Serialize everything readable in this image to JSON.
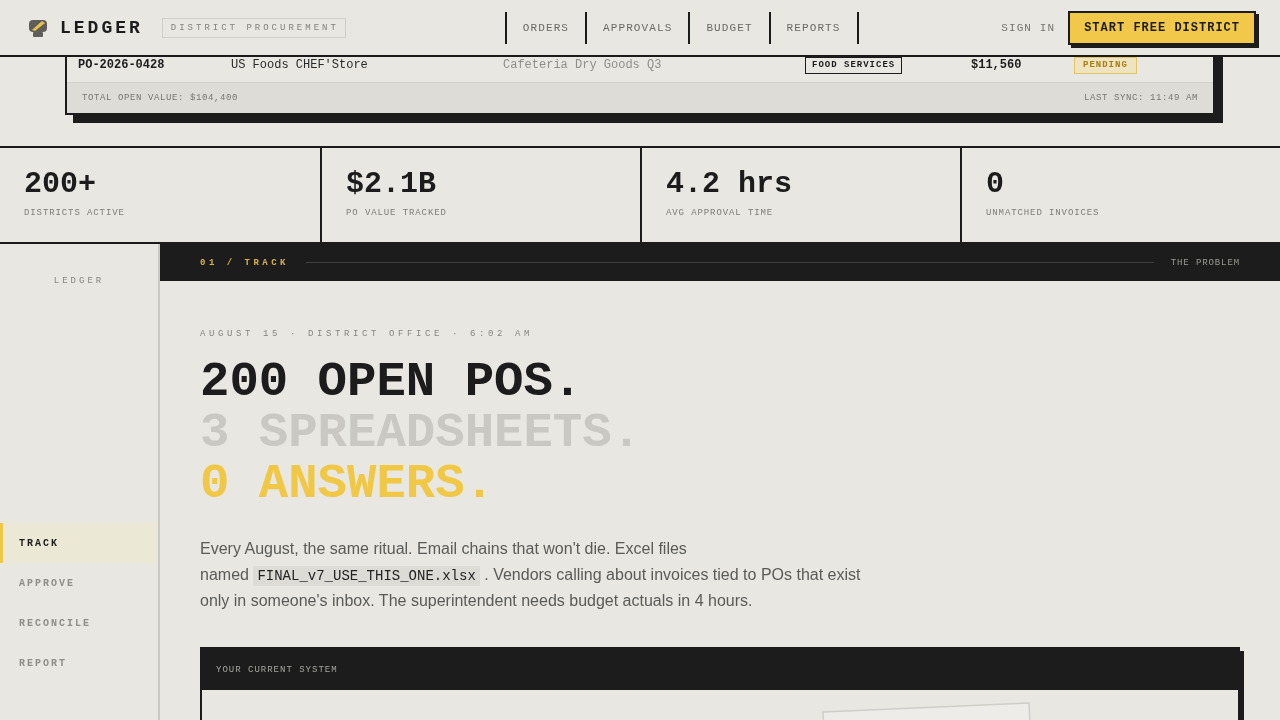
{
  "header": {
    "brand": "LEDGER",
    "tag": "DISTRICT PROCUREMENT",
    "nav": [
      {
        "label": "ORDERS"
      },
      {
        "label": "APPROVALS"
      },
      {
        "label": "BUDGET"
      },
      {
        "label": "REPORTS"
      }
    ],
    "sign_in": "SIGN IN",
    "cta": "START FREE DISTRICT"
  },
  "orders_table": {
    "rows": [
      {
        "cells": [
          {
            "kind": "strong",
            "text": "PO-2026-0428"
          },
          {
            "kind": "plain",
            "text": "US Foods CHEF'Store"
          },
          {
            "kind": "muted",
            "text": "Cafeteria Dry Goods Q3"
          },
          {
            "kind": "tag",
            "text": "FOOD SERVICES"
          },
          {
            "kind": "strong",
            "text": "$11,560"
          },
          {
            "kind": "status",
            "text": "PENDING"
          }
        ]
      }
    ],
    "footer": {
      "left": "TOTAL OPEN VALUE: $104,400",
      "right": "LAST SYNC: 11:49 AM"
    }
  },
  "stats": [
    {
      "value": "200+",
      "label": "DISTRICTS ACTIVE"
    },
    {
      "value": "$2.1B",
      "label": "PO VALUE TRACKED"
    },
    {
      "value": "4.2 hrs",
      "label": "AVG APPROVAL TIME"
    },
    {
      "value": "0",
      "label": "UNMATCHED INVOICES"
    }
  ],
  "sidebar": {
    "brand": "LEDGER",
    "items": [
      {
        "label": "TRACK",
        "selected": true
      },
      {
        "label": "APPROVE",
        "selected": false
      },
      {
        "label": "RECONCILE",
        "selected": false
      },
      {
        "label": "REPORT",
        "selected": false
      }
    ]
  },
  "section_bar": {
    "label": "01 / TRACK",
    "title": "THE PROBLEM"
  },
  "story": {
    "kicker": "AUGUST 15 · DISTRICT OFFICE · 6:02 AM",
    "headline": [
      {
        "kind": "dark",
        "text": "200 OPEN POS."
      },
      {
        "kind": "faded",
        "text": "3 SPREADSHEETS."
      },
      {
        "kind": "accent",
        "text": "0 ANSWERS."
      }
    ],
    "body": [
      {
        "kind": "text",
        "text": "Every August, the same ritual. Email chains that won't die. Excel files\nnamed "
      },
      {
        "kind": "code",
        "text": "FINAL_v7_USE_THIS_ONE.xlsx"
      },
      {
        "kind": "text",
        "text": " . Vendors calling about invoices tied to POs that exist only in someone's inbox. The superintendent needs budget actuals in 4 hours."
      }
    ],
    "system_panel": {
      "title": "YOUR CURRENT SYSTEM"
    }
  }
}
